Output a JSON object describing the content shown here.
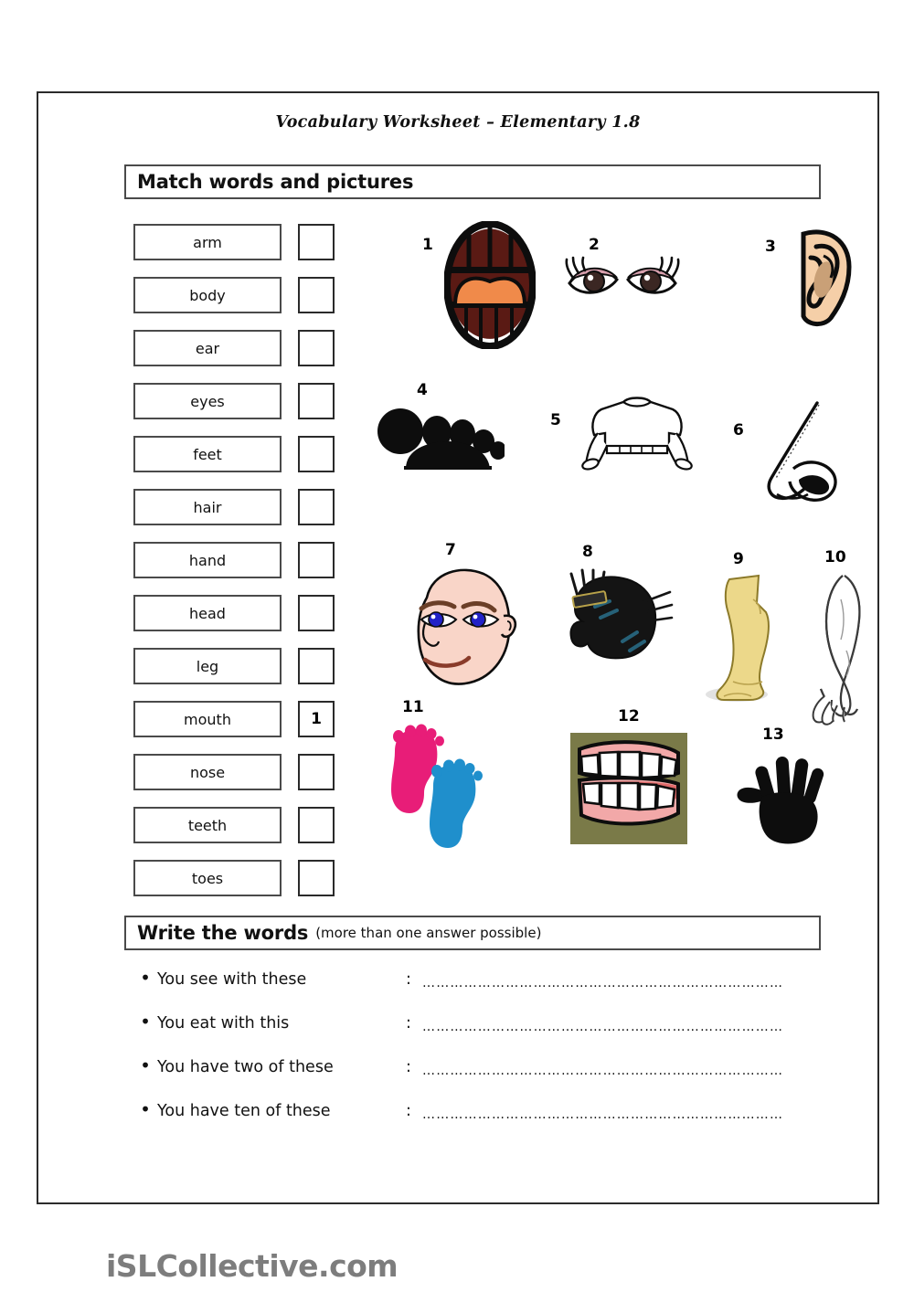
{
  "document": {
    "title": "Vocabulary Worksheet – Elementary 1.8",
    "footer_logo": "iSLCollective.com"
  },
  "sections": {
    "match": {
      "heading": "Match words and pictures"
    },
    "write": {
      "heading": "Write the words",
      "subheading": "(more than one answer possible)"
    }
  },
  "word_list": [
    {
      "word": "arm",
      "answer": ""
    },
    {
      "word": "body",
      "answer": ""
    },
    {
      "word": "ear",
      "answer": ""
    },
    {
      "word": "eyes",
      "answer": ""
    },
    {
      "word": "feet",
      "answer": ""
    },
    {
      "word": "hair",
      "answer": ""
    },
    {
      "word": "hand",
      "answer": ""
    },
    {
      "word": "head",
      "answer": ""
    },
    {
      "word": "leg",
      "answer": ""
    },
    {
      "word": "mouth",
      "answer": "1"
    },
    {
      "word": "nose",
      "answer": ""
    },
    {
      "word": "teeth",
      "answer": ""
    },
    {
      "word": "toes",
      "answer": ""
    }
  ],
  "pictures": [
    {
      "number": "1",
      "depicts": "open-mouth"
    },
    {
      "number": "2",
      "depicts": "pair-of-eyes"
    },
    {
      "number": "3",
      "depicts": "ear"
    },
    {
      "number": "4",
      "depicts": "toes-silhouette"
    },
    {
      "number": "5",
      "depicts": "body-torso-tshirt"
    },
    {
      "number": "6",
      "depicts": "nose-profile"
    },
    {
      "number": "7",
      "depicts": "bald-head-face"
    },
    {
      "number": "8",
      "depicts": "black-hair-with-comb"
    },
    {
      "number": "9",
      "depicts": "leg-and-foot"
    },
    {
      "number": "10",
      "depicts": "arm-with-hand"
    },
    {
      "number": "11",
      "depicts": "two-footprints"
    },
    {
      "number": "12",
      "depicts": "teeth-smile"
    },
    {
      "number": "13",
      "depicts": "handprint-silhouette"
    }
  ],
  "questions": [
    {
      "bullet": "•",
      "text": "You see with these",
      "colon": ":",
      "dots": "……………………………………………………………………"
    },
    {
      "bullet": "•",
      "text": "You eat with this",
      "colon": ":",
      "dots": "……………………………………………………………………"
    },
    {
      "bullet": "•",
      "text": "You have two of these",
      "colon": ":",
      "dots": "……………………………………………………………………"
    },
    {
      "bullet": "•",
      "text": "You have ten of these",
      "colon": ":",
      "dots": "……………………………………………………………………"
    }
  ],
  "colors": {
    "border": "#2b2b2b",
    "box_border": "#4a4a4a",
    "logo_gray": "#7d7d7d",
    "mouth_inner": "#5a1a14",
    "tongue": "#f08a4a",
    "ear_skin": "#f5cfa8",
    "ear_inner": "#c9a077",
    "eye_shadow": "#d9a0ae",
    "face_skin": "#f9d5c8",
    "eye_blue": "#2222c8",
    "leg_yellow": "#ecd88a",
    "foot_pink": "#e81d78",
    "foot_blue": "#1f8fcc",
    "teeth_bg": "#7a7a48",
    "gum_pink": "#f2a8a8",
    "black": "#0d0d0d"
  }
}
